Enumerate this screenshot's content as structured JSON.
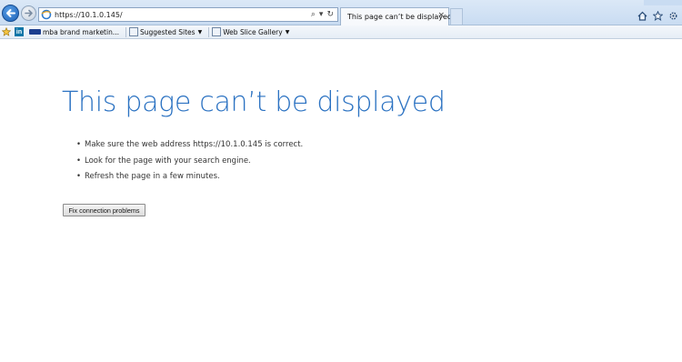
{
  "browser": {
    "address_url": "https://10.1.0.145/",
    "tab_title": "This page can’t be displayed",
    "tab_close": "×",
    "address_search_glyph": "⌕",
    "address_refresh_glyph": "↻",
    "icons": [
      "back-arrow-icon",
      "forward-arrow-icon",
      "ie-page-icon",
      "search-icon",
      "refresh-icon",
      "home-icon",
      "star-icon",
      "gear-icon"
    ]
  },
  "favorites": {
    "items": [
      {
        "label": "mba brand marketin..."
      },
      {
        "label": "Suggested Sites"
      },
      {
        "label": "Web Slice Gallery"
      }
    ]
  },
  "content": {
    "headline": "This page can’t be displayed",
    "bullets": [
      "Make sure the web address https://10.1.0.145 is correct.",
      "Look for the page with your search engine.",
      "Refresh the page in a few minutes."
    ],
    "fix_button": "Fix connection problems"
  },
  "colors": {
    "headline": "#2b72c2",
    "chrome": "#c9dcf2"
  }
}
